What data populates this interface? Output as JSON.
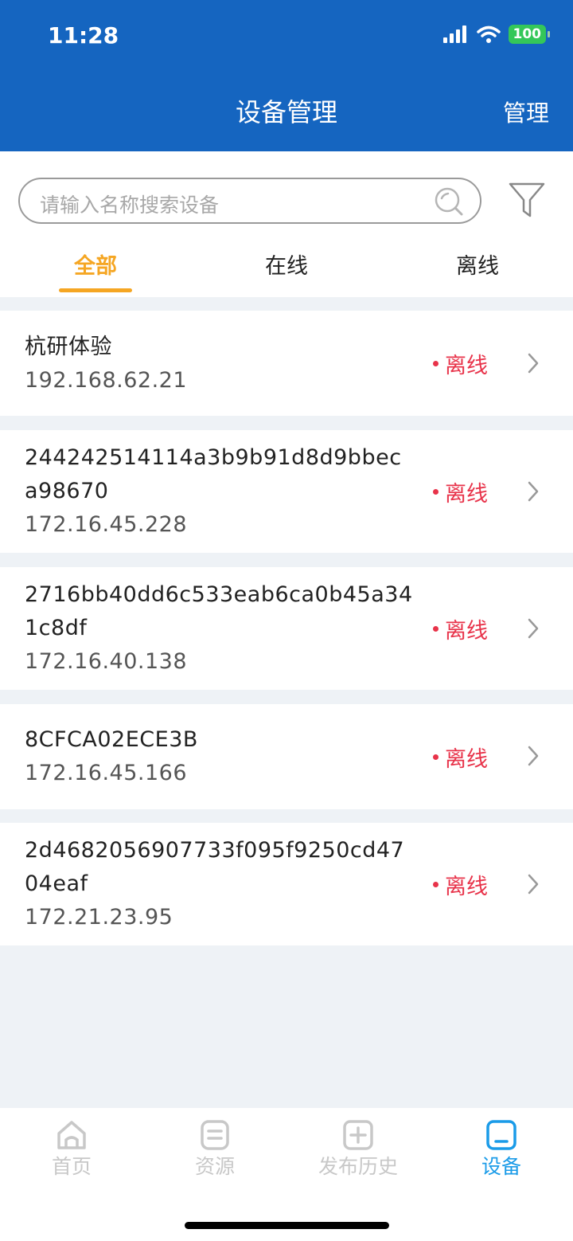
{
  "status_bar": {
    "time": "11:28",
    "battery": "100"
  },
  "header": {
    "title": "设备管理",
    "manage_label": "管理"
  },
  "search": {
    "placeholder": "请输入名称搜索设备"
  },
  "tabs": [
    {
      "label": "全部",
      "active": true
    },
    {
      "label": "在线",
      "active": false
    },
    {
      "label": "离线",
      "active": false
    }
  ],
  "devices": [
    {
      "name": "杭研体验",
      "ip": "192.168.62.21",
      "status": "离线"
    },
    {
      "name": "244242514114a3b9b91d8d9bbeca98670",
      "ip": "172.16.45.228",
      "status": "离线"
    },
    {
      "name": "2716bb40dd6c533eab6ca0b45a341c8df",
      "ip": "172.16.40.138",
      "status": "离线"
    },
    {
      "name": "8CFCA02ECE3B",
      "ip": "172.16.45.166",
      "status": "离线"
    },
    {
      "name": "2d4682056907733f095f9250cd4704eaf",
      "ip": "172.21.23.95",
      "status": "离线"
    }
  ],
  "bottom_nav": [
    {
      "label": "首页",
      "icon": "home-icon",
      "active": false
    },
    {
      "label": "资源",
      "icon": "document-icon",
      "active": false
    },
    {
      "label": "发布历史",
      "icon": "plus-square-icon",
      "active": false
    },
    {
      "label": "设备",
      "icon": "device-icon",
      "active": true
    }
  ],
  "colors": {
    "header": "#1565c0",
    "accent": "#f5a623",
    "offline": "#e8334a",
    "nav_active": "#1a9be8"
  }
}
